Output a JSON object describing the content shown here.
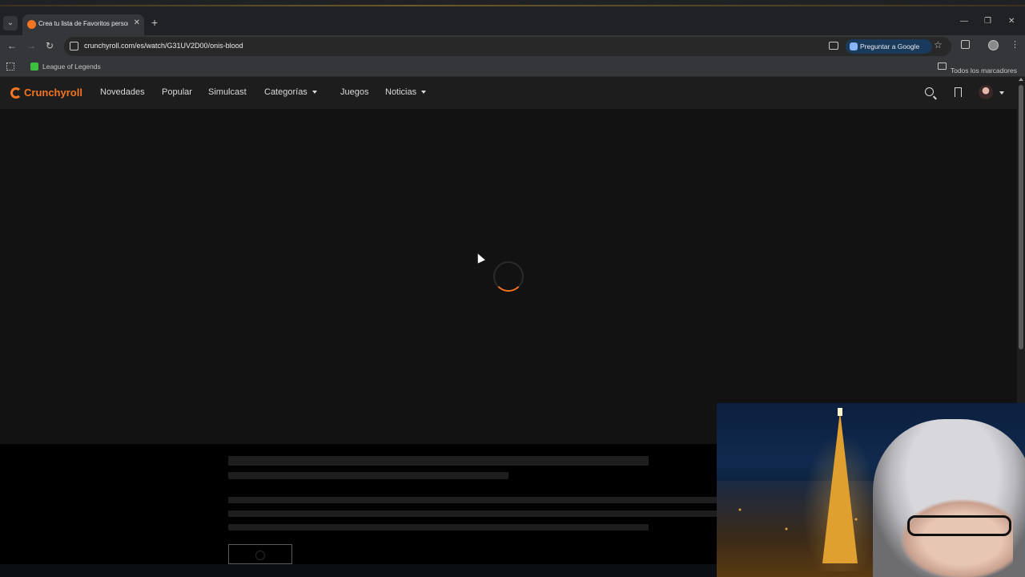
{
  "browser": {
    "tab": {
      "title": "Crea tu lista de Favoritos personalizada",
      "close_glyph": "✕"
    },
    "new_tab_glyph": "+",
    "tab_menu_glyph": "⌄",
    "window_controls": {
      "minimize": "—",
      "maximize": "❐",
      "close": "✕"
    },
    "nav": {
      "back": "←",
      "forward": "→",
      "reload": "↻"
    },
    "url": "crunchyroll.com/es/watch/G31UV2D00/onis-blood",
    "ask_google_label": "Preguntar a Google",
    "star_glyph": "☆",
    "menu_glyph": "⋮",
    "bookmarks": {
      "items": [
        {
          "label": "League of Legends"
        }
      ],
      "all_label": "Todos los marcadores"
    }
  },
  "site": {
    "brand": "Crunchyroll",
    "nav": [
      {
        "label": "Novedades"
      },
      {
        "label": "Popular"
      },
      {
        "label": "Simulcast"
      },
      {
        "label": "Categorías"
      },
      {
        "label": "Juegos"
      },
      {
        "label": "Noticias"
      }
    ],
    "accent_color": "#f47521"
  },
  "player": {
    "state": "loading"
  }
}
